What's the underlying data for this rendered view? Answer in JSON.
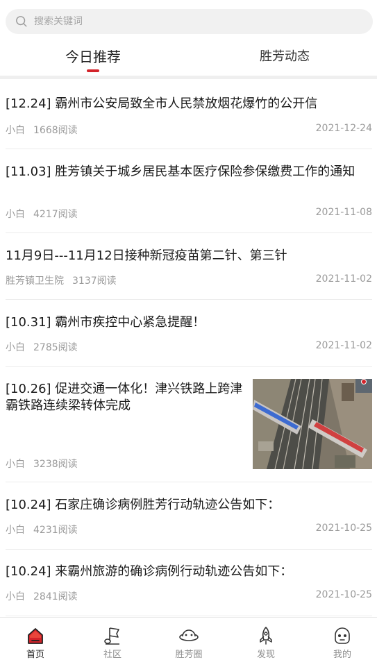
{
  "search": {
    "placeholder": "搜索关键词"
  },
  "tabs": [
    {
      "label": "今日推荐",
      "active": true
    },
    {
      "label": "胜芳动态",
      "active": false
    }
  ],
  "articles": [
    {
      "title": "[12.24] 霸州市公安局致全市人民禁放烟花爆竹的公开信",
      "author": "小白",
      "reads": "1668阅读",
      "date": "2021-12-24"
    },
    {
      "title": "[11.03] 胜芳镇关于城乡居民基本医疗保险参保缴费工作的通知",
      "author": "小白",
      "reads": "4217阅读",
      "date": "2021-11-08"
    },
    {
      "title": "11月9日---11月12日接种新冠疫苗第二针、第三针",
      "author": "胜芳镇卫生院",
      "reads": "3137阅读",
      "date": "2021-11-02"
    },
    {
      "title": "[10.31] 霸州市疾控中心紧急提醒！",
      "author": "小白",
      "reads": "2785阅读",
      "date": "2021-11-02"
    },
    {
      "title": "[10.26] 促进交通一体化！津兴铁路上跨津霸铁路连续梁转体完成",
      "author": "小白",
      "reads": "3238阅读",
      "date": "",
      "has_image": true
    },
    {
      "title": "[10.24] 石家庄确诊病例胜芳行动轨迹公告如下：",
      "author": "小白",
      "reads": "4231阅读",
      "date": "2021-10-25"
    },
    {
      "title": "[10.24] 来霸州旅游的确诊病例行动轨迹公告如下：",
      "author": "小白",
      "reads": "2841阅读",
      "date": "2021-10-25"
    }
  ],
  "nav": [
    {
      "label": "首页",
      "icon": "home-icon",
      "active": true
    },
    {
      "label": "社区",
      "icon": "flag-icon",
      "active": false
    },
    {
      "label": "胜芳圈",
      "icon": "planet-icon",
      "active": false
    },
    {
      "label": "发现",
      "icon": "rocket-icon",
      "active": false
    },
    {
      "label": "我的",
      "icon": "profile-icon",
      "active": false
    }
  ],
  "colors": {
    "accent": "#d3232a",
    "muted_text": "#9a9a9a"
  }
}
